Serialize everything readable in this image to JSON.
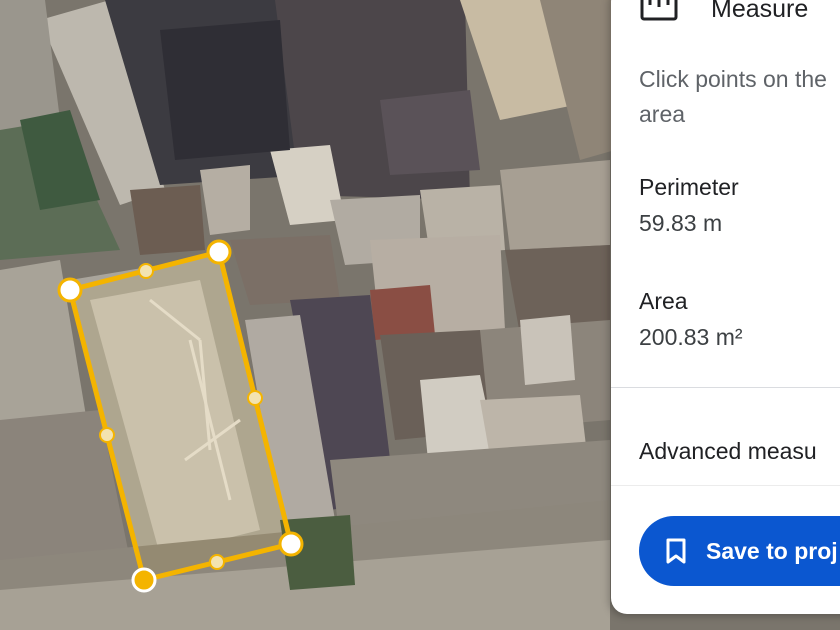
{
  "panel": {
    "icon": "ruler-icon",
    "title": "Measure",
    "instructions_line1": "Click points on the",
    "instructions_line2": "area",
    "perimeter_label": "Perimeter",
    "perimeter_value": "59.83 m",
    "area_label": "Area",
    "area_value": "200.83 m²",
    "advanced_label": "Advanced measu",
    "save_button": {
      "icon": "bookmark-icon",
      "label": "Save to proj"
    }
  },
  "measurement": {
    "shape": "polygon",
    "vertex_count": 4,
    "line_color": "#f4b400",
    "vertex_fill": "#ffffff",
    "last_vertex_fill": "#f4b400"
  },
  "colors": {
    "accent": "#0b57d0",
    "measure_line": "#f4b400"
  }
}
